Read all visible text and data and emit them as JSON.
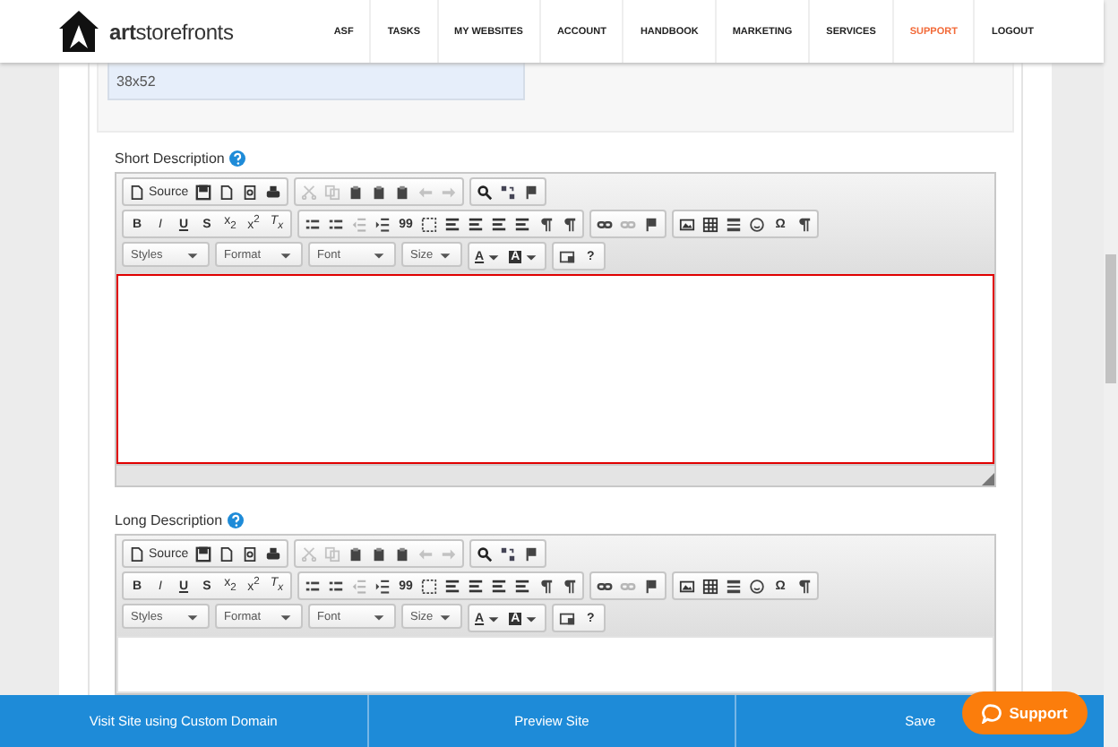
{
  "header": {
    "logo_text": "**art**storefronts",
    "nav": [
      {
        "label": "ASF",
        "selected": false
      },
      {
        "label": "TASKS",
        "selected": false
      },
      {
        "label": "MY WEBSITES",
        "selected": false
      },
      {
        "label": "ACCOUNT",
        "selected": false
      },
      {
        "label": "HANDBOOK",
        "selected": false
      },
      {
        "label": "MARKETING",
        "selected": false
      },
      {
        "label": "SERVICES",
        "selected": false
      },
      {
        "label": "SUPPORT",
        "selected": true
      },
      {
        "label": "LOGOUT",
        "selected": false
      }
    ]
  },
  "size_field": {
    "value": "38x52"
  },
  "editors": [
    {
      "label": "Short Description",
      "invalid": true,
      "toolbar": [
        [
          [
            {
              "kind": "source",
              "label": "Source"
            },
            {
              "kind": "save"
            },
            {
              "kind": "new"
            },
            {
              "kind": "preview"
            },
            {
              "kind": "print"
            }
          ],
          [
            {
              "kind": "cut",
              "disabled": true
            },
            {
              "kind": "copy",
              "disabled": true
            },
            {
              "kind": "paste"
            },
            {
              "kind": "paste"
            },
            {
              "kind": "paste"
            },
            {
              "kind": "undo",
              "disabled": true
            },
            {
              "kind": "redo",
              "disabled": true
            }
          ],
          [
            {
              "kind": "find"
            },
            {
              "kind": "replace"
            },
            {
              "kind": "flag"
            }
          ]
        ],
        [
          [
            {
              "kind": "bold",
              "label": "B"
            },
            {
              "kind": "italic",
              "label": "I"
            },
            {
              "kind": "underline",
              "label": "U"
            },
            {
              "kind": "strike",
              "label": "S"
            },
            {
              "kind": "plain",
              "label": "x$_{2}$"
            },
            {
              "kind": "plain",
              "label": "x$^{2}$"
            },
            {
              "kind": "italic",
              "label": "T$_{x}$"
            }
          ],
          [
            {
              "kind": "list"
            },
            {
              "kind": "list"
            },
            {
              "kind": "outdent",
              "disabled": true
            },
            {
              "kind": "indent"
            },
            {
              "kind": "bold",
              "label": "99"
            },
            {
              "kind": "div"
            },
            {
              "kind": "align"
            },
            {
              "kind": "align"
            },
            {
              "kind": "align"
            },
            {
              "kind": "align"
            },
            {
              "kind": "para"
            },
            {
              "kind": "para"
            }
          ],
          [
            {
              "kind": "link"
            },
            {
              "kind": "link",
              "disabled": true
            },
            {
              "kind": "flag"
            }
          ],
          [
            {
              "kind": "image"
            },
            {
              "kind": "table"
            },
            {
              "kind": "rule"
            },
            {
              "kind": "smiley"
            },
            {
              "kind": "bold",
              "label": "Ω"
            },
            {
              "kind": "para"
            }
          ]
        ],
        [
          [
            {
              "kind": "dropdown",
              "label": "Styles"
            },
            {
              "kind": "dropdown",
              "label": "Format"
            },
            {
              "kind": "dropdown",
              "label": "Font"
            },
            {
              "kind": "dropdown",
              "label": "Size"
            }
          ],
          [
            {
              "kind": "color",
              "label": "A"
            },
            {
              "kind": "bgcolor",
              "label": "A"
            }
          ],
          [
            {
              "kind": "maximize"
            },
            {
              "kind": "bold",
              "label": "?"
            }
          ]
        ]
      ]
    },
    {
      "label": "Long Description",
      "invalid": false,
      "toolbar": [
        [
          [
            {
              "kind": "source",
              "label": "Source"
            },
            {
              "kind": "save"
            },
            {
              "kind": "new"
            },
            {
              "kind": "preview"
            },
            {
              "kind": "print"
            }
          ],
          [
            {
              "kind": "cut",
              "disabled": true
            },
            {
              "kind": "copy",
              "disabled": true
            },
            {
              "kind": "paste"
            },
            {
              "kind": "paste"
            },
            {
              "kind": "paste"
            },
            {
              "kind": "undo",
              "disabled": true
            },
            {
              "kind": "redo",
              "disabled": true
            }
          ],
          [
            {
              "kind": "find"
            },
            {
              "kind": "replace"
            },
            {
              "kind": "flag"
            }
          ]
        ],
        [
          [
            {
              "kind": "bold",
              "label": "B"
            },
            {
              "kind": "italic",
              "label": "I"
            },
            {
              "kind": "underline",
              "label": "U"
            },
            {
              "kind": "strike",
              "label": "S"
            },
            {
              "kind": "plain",
              "label": "x$_{2}$"
            },
            {
              "kind": "plain",
              "label": "x$^{2}$"
            },
            {
              "kind": "italic",
              "label": "T$_{x}$"
            }
          ],
          [
            {
              "kind": "list"
            },
            {
              "kind": "list"
            },
            {
              "kind": "outdent",
              "disabled": true
            },
            {
              "kind": "indent"
            },
            {
              "kind": "bold",
              "label": "99"
            },
            {
              "kind": "div"
            },
            {
              "kind": "align"
            },
            {
              "kind": "align"
            },
            {
              "kind": "align"
            },
            {
              "kind": "align"
            },
            {
              "kind": "para"
            },
            {
              "kind": "para"
            }
          ],
          [
            {
              "kind": "link"
            },
            {
              "kind": "link",
              "disabled": true
            },
            {
              "kind": "flag"
            }
          ],
          [
            {
              "kind": "image"
            },
            {
              "kind": "table"
            },
            {
              "kind": "rule"
            },
            {
              "kind": "smiley"
            },
            {
              "kind": "bold",
              "label": "Ω"
            },
            {
              "kind": "para"
            }
          ]
        ],
        [
          [
            {
              "kind": "dropdown",
              "label": "Styles"
            },
            {
              "kind": "dropdown",
              "label": "Format"
            },
            {
              "kind": "dropdown",
              "label": "Font"
            },
            {
              "kind": "dropdown",
              "label": "Size"
            }
          ],
          [
            {
              "kind": "color",
              "label": "A"
            },
            {
              "kind": "bgcolor",
              "label": "A"
            }
          ],
          [
            {
              "kind": "maximize"
            },
            {
              "kind": "bold",
              "label": "?"
            }
          ]
        ]
      ]
    }
  ],
  "footer": {
    "buttons": [
      "Visit Site using Custom Domain",
      "Preview Site",
      "Save"
    ]
  },
  "support_button": {
    "label": "Support"
  }
}
